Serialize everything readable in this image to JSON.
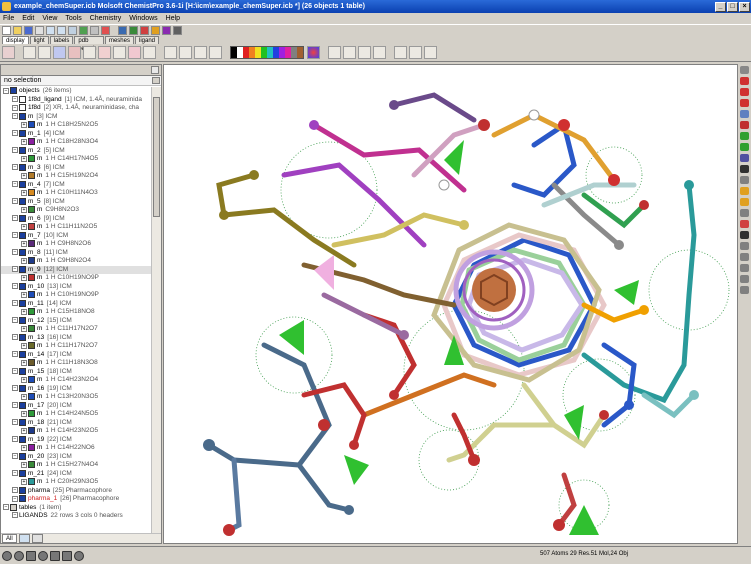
{
  "window": {
    "title": "example_chemSuper.icb Molsoft ChemistPro 3.6-1i  [H:\\icm\\example_chemSuper.icb *] (26 objects 1 table)"
  },
  "menu": [
    "File",
    "Edit",
    "View",
    "Tools",
    "Chemistry",
    "Windows",
    "Help"
  ],
  "tabs": [
    "display",
    "light",
    "labels",
    "pdb search",
    "meshes",
    "ligand"
  ],
  "panel": {
    "selection": "no selection"
  },
  "tree": [
    {
      "level": 0,
      "name": "objects",
      "info": "(26 items)",
      "icon": "#1b3f9e"
    },
    {
      "level": 1,
      "name": "1f8d_ligand",
      "info": "[1] ICM, 1.4Å, neuraminida",
      "icon": "#fff"
    },
    {
      "level": 1,
      "name": "1f8d",
      "info": "[2] XR, 1.4Å, neuraminidase, cha",
      "icon": "#fff"
    },
    {
      "level": 1,
      "name": "m",
      "info": "[3] ICM",
      "icon": "#1b3f9e"
    },
    {
      "level": 2,
      "name": "m",
      "info": "1 H   C18H25N2O5",
      "icon": "#1e4db7"
    },
    {
      "level": 1,
      "name": "m_1",
      "info": "[4] ICM",
      "icon": "#1b3f9e"
    },
    {
      "level": 2,
      "name": "m",
      "info": "1 H   C18H28N3O4",
      "icon": "#8a1fa0"
    },
    {
      "level": 1,
      "name": "m_2",
      "info": "[5] ICM",
      "icon": "#1b3f9e"
    },
    {
      "level": 2,
      "name": "m",
      "info": "1 H   C14H17N4O5",
      "icon": "#2e9a3a"
    },
    {
      "level": 1,
      "name": "m_3",
      "info": "[6] ICM",
      "icon": "#1b3f9e"
    },
    {
      "level": 2,
      "name": "m",
      "info": "1 H   C15H19N2O4",
      "icon": "#b07a2a"
    },
    {
      "level": 1,
      "name": "m_4",
      "info": "[7] ICM",
      "icon": "#1b3f9e"
    },
    {
      "level": 2,
      "name": "m",
      "info": "1 H   C10H11N4O3",
      "icon": "#d68a20"
    },
    {
      "level": 1,
      "name": "m_5",
      "info": "[8] ICM",
      "icon": "#1b3f9e"
    },
    {
      "level": 2,
      "name": "m",
      "info": "C9H8N2O3",
      "icon": "#3a8a3a"
    },
    {
      "level": 1,
      "name": "m_6",
      "info": "[9] ICM",
      "icon": "#1b3f9e"
    },
    {
      "level": 2,
      "name": "m",
      "info": "1 H   C11H11N2O5",
      "icon": "#c04040"
    },
    {
      "level": 1,
      "name": "m_7",
      "info": "[10] ICM",
      "icon": "#1b3f9e"
    },
    {
      "level": 2,
      "name": "m",
      "info": "1 H   C9H8N2O6",
      "icon": "#5a2a7a"
    },
    {
      "level": 1,
      "name": "m_8",
      "info": "[11] ICM",
      "icon": "#1b3f9e"
    },
    {
      "level": 2,
      "name": "m",
      "info": "1 H   C9H8N2O4",
      "icon": "#1e3a8a"
    },
    {
      "level": 1,
      "name": "m_9",
      "info": "[12] ICM",
      "icon": "#1b3f9e",
      "highlight": true
    },
    {
      "level": 2,
      "name": "m",
      "info": "1 H   C10H19NO9P",
      "icon": "#c03030"
    },
    {
      "level": 1,
      "name": "m_10",
      "info": "[13] ICM",
      "icon": "#1b3f9e"
    },
    {
      "level": 2,
      "name": "m",
      "info": "1 H   C10H19NO9P",
      "icon": "#1e4db7"
    },
    {
      "level": 1,
      "name": "m_11",
      "info": "[14] ICM",
      "icon": "#1b3f9e"
    },
    {
      "level": 2,
      "name": "m",
      "info": "1 H   C15H18NO8",
      "icon": "#2e9a3a"
    },
    {
      "level": 1,
      "name": "m_12",
      "info": "[15] ICM",
      "icon": "#1b3f9e"
    },
    {
      "level": 2,
      "name": "m",
      "info": "1 H   C11H17N2O7",
      "icon": "#3a8a3a"
    },
    {
      "level": 1,
      "name": "m_13",
      "info": "[16] ICM",
      "icon": "#1b3f9e"
    },
    {
      "level": 2,
      "name": "m",
      "info": "1 H   C11H17N2O7",
      "icon": "#6a6a2a"
    },
    {
      "level": 1,
      "name": "m_14",
      "info": "[17] ICM",
      "icon": "#1b3f9e"
    },
    {
      "level": 2,
      "name": "m",
      "info": "1 H   C11H18N3O8",
      "icon": "#6a5a2a"
    },
    {
      "level": 1,
      "name": "m_15",
      "info": "[18] ICM",
      "icon": "#1b3f9e"
    },
    {
      "level": 2,
      "name": "m",
      "info": "1 H   C14H23N2O4",
      "icon": "#1e4db7"
    },
    {
      "level": 1,
      "name": "m_16",
      "info": "[19] ICM",
      "icon": "#1b3f9e"
    },
    {
      "level": 2,
      "name": "m",
      "info": "1 H   C13H20N3O5",
      "icon": "#1e4db7"
    },
    {
      "level": 1,
      "name": "m_17",
      "info": "[20] ICM",
      "icon": "#1b3f9e"
    },
    {
      "level": 2,
      "name": "m",
      "info": "1 H   C14H24N5O5",
      "icon": "#2e9a3a"
    },
    {
      "level": 1,
      "name": "m_18",
      "info": "[21] ICM",
      "icon": "#1b3f9e"
    },
    {
      "level": 2,
      "name": "m",
      "info": "1 H   C14H23N2O5",
      "icon": "#1e3a8a"
    },
    {
      "level": 1,
      "name": "m_19",
      "info": "[22] ICM",
      "icon": "#1b3f9e"
    },
    {
      "level": 2,
      "name": "m",
      "info": "1 H   C14H22NO6",
      "icon": "#8a1fa0"
    },
    {
      "level": 1,
      "name": "m_20",
      "info": "[23] ICM",
      "icon": "#1b3f9e"
    },
    {
      "level": 2,
      "name": "m",
      "info": "1 H   C15H27N4O4",
      "icon": "#3a8a3a"
    },
    {
      "level": 1,
      "name": "m_21",
      "info": "[24] ICM",
      "icon": "#1b3f9e"
    },
    {
      "level": 2,
      "name": "m",
      "info": "1 H   C20H29N3O5",
      "icon": "#2a9a9a"
    },
    {
      "level": 1,
      "name": "pharma",
      "info": "[25] Pharmacophore",
      "icon": "#1b3f9e"
    },
    {
      "level": 1,
      "name": "pharma_1",
      "info": "[26] Pharmacophore",
      "icon": "#1b3f9e",
      "red": true
    },
    {
      "level": 0,
      "name": "tables",
      "info": "(1 item)",
      "icon": "#d4d0c8"
    },
    {
      "level": 1,
      "name": "LIGANDS",
      "info": "22 rows 3 cols 0 headers",
      "icon": "none"
    }
  ],
  "bottom_tabs": [
    "All"
  ],
  "status": {
    "text": "507 Atoms 29 Res.51 Mol,24 Obj"
  },
  "colors": {
    "title_bar": "#0a40b0",
    "chrome": "#d4d0c8"
  }
}
